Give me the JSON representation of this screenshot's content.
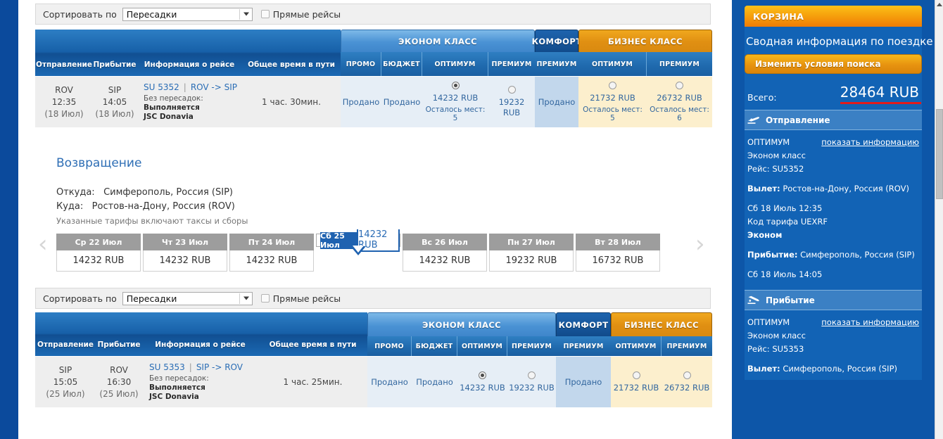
{
  "sortbars": [
    {
      "label": "Сортировать по",
      "select_value": "Пересадки",
      "checkbox_label": "Прямые рейсы"
    },
    {
      "label": "Сортировать по",
      "select_value": "Пересадки",
      "checkbox_label": "Прямые рейсы"
    }
  ],
  "table_headers": {
    "departure": "Отправление",
    "arrival": "Прибытие",
    "flight_info": "Информация о рейсе",
    "total_time": "Общее время в пути",
    "groups": [
      {
        "name": "ЭКОНОМ КЛАСС",
        "type": "eco",
        "subs": [
          "ПРОМО",
          "БЮДЖЕТ",
          "ОПТИМУМ",
          "ПРЕМИУМ"
        ]
      },
      {
        "name": "КОМФОРТ",
        "type": "com",
        "subs": [
          "ПРЕМИУМ"
        ]
      },
      {
        "name": "БИЗНЕС КЛАСС",
        "type": "biz",
        "subs": [
          "ОПТИМУМ",
          "ПРЕМИУМ"
        ]
      }
    ]
  },
  "outbound_flight": {
    "dep_code": "ROV",
    "dep_time": "12:35",
    "dep_date": "(18 Июл)",
    "arr_code": "SIP",
    "arr_time": "14:05",
    "arr_date": "(18 Июл)",
    "flight_no": "SU 5352",
    "route": "ROV -> SIP",
    "stops_label": "Без пересадок:",
    "operated_label": "Выполняется",
    "carrier": "JSC Donavia",
    "duration": "1 час. 30мин.",
    "fares": [
      {
        "type": "eco",
        "state": "sold",
        "text": "Продано"
      },
      {
        "type": "eco",
        "state": "sold",
        "text": "Продано"
      },
      {
        "type": "eco",
        "state": "selected",
        "price": "14232 RUB",
        "seats": "Осталось мест: 5"
      },
      {
        "type": "eco",
        "state": "available",
        "price": "19232 RUB",
        "seats": ""
      },
      {
        "type": "com",
        "state": "sold",
        "text": "Продано"
      },
      {
        "type": "biz",
        "state": "available",
        "price": "21732 RUB",
        "seats": "Осталось мест: 5"
      },
      {
        "type": "biz",
        "state": "available",
        "price": "26732 RUB",
        "seats": "Осталось мест: 6"
      }
    ]
  },
  "return_section": {
    "title": "Возвращение",
    "from_label": "Откуда:",
    "from_value": "Симферополь, Россия (SIP)",
    "to_label": "Куда:",
    "to_value": "Ростов-на-Дону, Россия (ROV)",
    "note": "Указанные тарифы включают таксы и сборы",
    "prev_arrow": "‹",
    "next_arrow": "›",
    "dates": [
      {
        "day": "Ср 22 Июл",
        "price": "14232 RUB",
        "selected": false
      },
      {
        "day": "Чт 23 Июл",
        "price": "14232 RUB",
        "selected": false
      },
      {
        "day": "Пт 24 Июл",
        "price": "14232 RUB",
        "selected": false
      },
      {
        "day": "Сб 25 Июл",
        "price": "14232 RUB",
        "selected": true
      },
      {
        "day": "Вс 26 Июл",
        "price": "14232 RUB",
        "selected": false
      },
      {
        "day": "Пн 27 Июл",
        "price": "19232 RUB",
        "selected": false
      },
      {
        "day": "Вт 28 Июл",
        "price": "16732 RUB",
        "selected": false
      }
    ]
  },
  "return_flight": {
    "dep_code": "SIP",
    "dep_time": "15:05",
    "dep_date": "(25 Июл)",
    "arr_code": "ROV",
    "arr_time": "16:30",
    "arr_date": "(25 Июл)",
    "flight_no": "SU 5353",
    "route": "SIP -> ROV",
    "stops_label": "Без пересадок:",
    "operated_label": "Выполняется",
    "carrier": "JSC Donavia",
    "duration": "1 час. 25мин.",
    "fares": [
      {
        "type": "eco",
        "state": "sold",
        "text": "Продано"
      },
      {
        "type": "eco",
        "state": "sold",
        "text": "Продано"
      },
      {
        "type": "eco",
        "state": "selected",
        "price": "14232 RUB",
        "seats": ""
      },
      {
        "type": "eco",
        "state": "available",
        "price": "19232 RUB",
        "seats": ""
      },
      {
        "type": "com",
        "state": "sold",
        "text": "Продано"
      },
      {
        "type": "biz",
        "state": "available",
        "price": "21732 RUB",
        "seats": ""
      },
      {
        "type": "biz",
        "state": "available",
        "price": "26732 RUB",
        "seats": ""
      }
    ]
  },
  "cart": {
    "header": "КОРЗИНА",
    "summary_title": "Сводная информация по поездке",
    "change_button": "Изменить условия поиска",
    "total_label": "Всего:",
    "total_value": "28464 RUB",
    "accent_underline": "#e11b1b",
    "sections": [
      {
        "icon": "airplane-takeoff-icon",
        "title": "Отправление",
        "fare_name": "ОПТИМУМ",
        "link": "показать информацию",
        "class_name": "Эконом класс",
        "flight_label": "Рейс: SU5352",
        "dep_label": "Вылет:",
        "dep_value": "Ростов-на-Дону, Россия (ROV)",
        "dep_datetime": "Сб 18 Июль 12:35",
        "fare_code": "Код тарифа UEXRF",
        "cabin": "Эконом",
        "arr_label": "Прибытие:",
        "arr_value": "Симферополь, Россия (SIP)",
        "arr_datetime": "Сб 18 Июль 14:05"
      },
      {
        "icon": "airplane-landing-icon",
        "title": "Прибытие",
        "fare_name": "ОПТИМУМ",
        "link": "показать информацию",
        "class_name": "Эконом класс",
        "flight_label": "Рейс: SU5353",
        "dep_label": "Вылет:",
        "dep_value": "Симферополь, Россия (SIP)",
        "dep_datetime": "",
        "fare_code": "",
        "cabin": "",
        "arr_label": "",
        "arr_value": "",
        "arr_datetime": ""
      }
    ]
  }
}
